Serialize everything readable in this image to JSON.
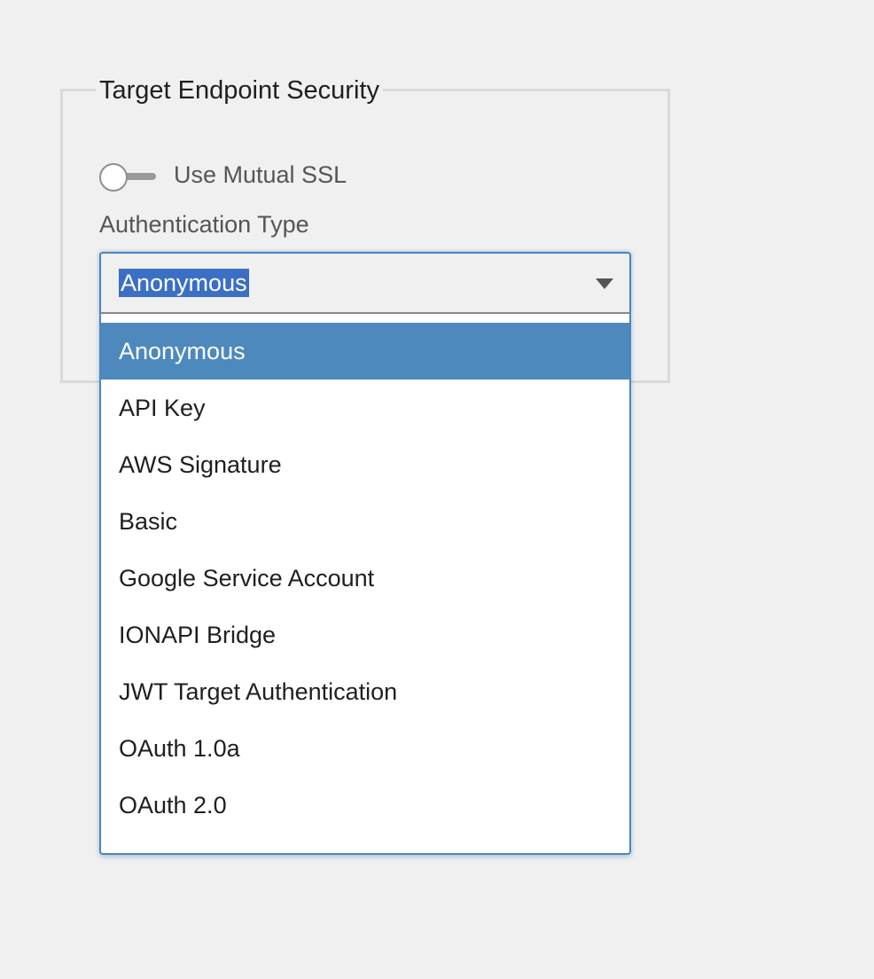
{
  "section": {
    "title": "Target Endpoint Security"
  },
  "mutual_ssl": {
    "label": "Use Mutual SSL",
    "enabled": false
  },
  "auth": {
    "label": "Authentication Type",
    "selected": "Anonymous",
    "options": [
      "Anonymous",
      "API Key",
      "AWS Signature",
      "Basic",
      "Google Service Account",
      "IONAPI Bridge",
      "JWT Target Authentication",
      "OAuth 1.0a",
      "OAuth 2.0"
    ]
  },
  "colors": {
    "accent": "#4a87bf",
    "selected_option": "#4d89bd",
    "text_selection": "#3a6fc4",
    "background": "#f0f0f0"
  },
  "icons": {
    "select_caret": "caret-down-icon"
  }
}
